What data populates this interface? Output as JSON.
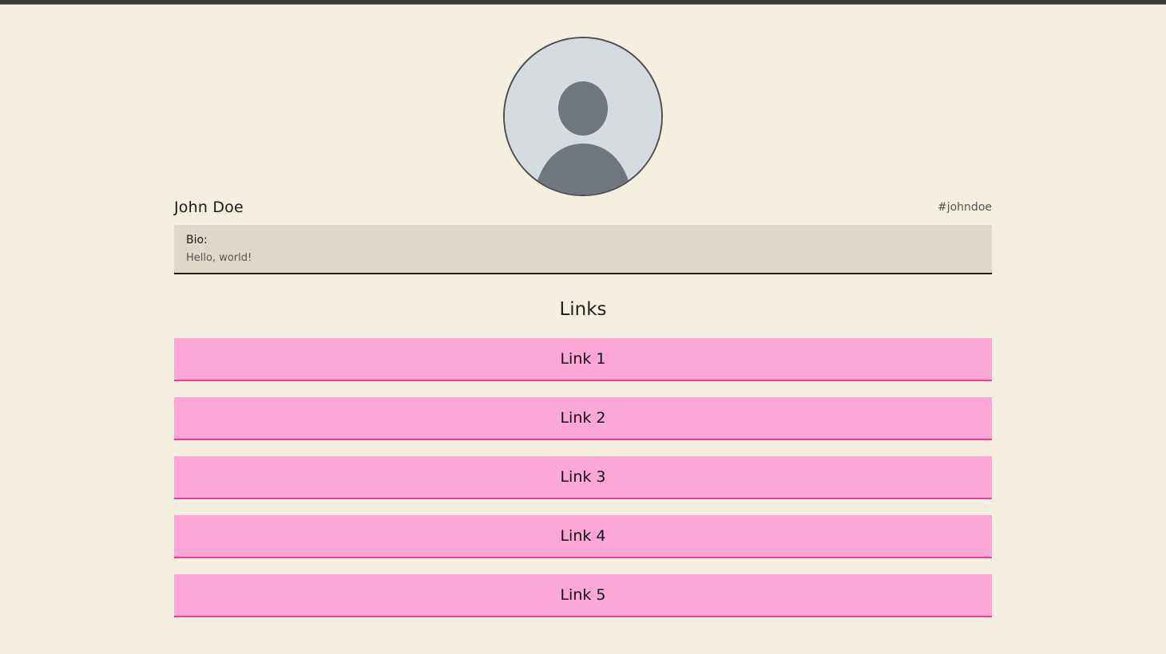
{
  "profile": {
    "avatar_icon": "user-silhouette-icon",
    "name": "John Doe",
    "handle": "#johndoe"
  },
  "bio": {
    "label": "Bio:",
    "text": "Hello, world!"
  },
  "links": {
    "heading": "Links",
    "items": [
      {
        "label": "Link 1"
      },
      {
        "label": "Link 2"
      },
      {
        "label": "Link 3"
      },
      {
        "label": "Link 4"
      },
      {
        "label": "Link 5"
      }
    ]
  },
  "colors": {
    "background": "#f5efe1",
    "bio_background": "#dfd7ca",
    "link_background": "#fda7d6",
    "link_border": "#ec3b9a",
    "avatar_background": "#d6dbe0",
    "avatar_silhouette": "#6f767e"
  }
}
